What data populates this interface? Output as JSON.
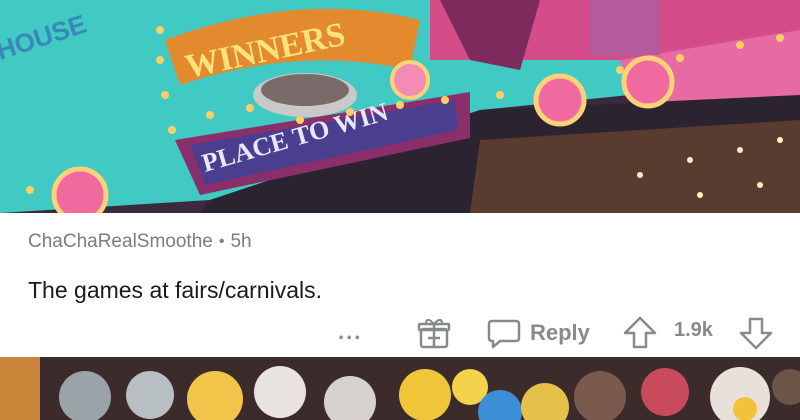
{
  "sign": {
    "winners_text": "WINNERS",
    "place_text": "PLACE TO WIN",
    "house_text": "HOUSE"
  },
  "comment": {
    "username": "ChaChaRealSmoothe",
    "separator": "•",
    "age": "5h",
    "text": "The games at fairs/carnivals.",
    "more_label": "...",
    "reply_label": "Reply",
    "score": "1.9k"
  },
  "icons": {
    "more": "more-options-icon",
    "award": "award-gift-icon",
    "reply": "reply-speech-bubble-icon",
    "upvote": "upvote-arrow-icon",
    "downvote": "downvote-arrow-icon"
  },
  "colors": {
    "meta_text": "#7c7c7c",
    "body_text": "#1a1a1b",
    "action_gray": "#878a8c",
    "sign_teal": "#41c9c4",
    "sign_pink": "#e83b8e",
    "sign_purple": "#4a3f8f"
  }
}
